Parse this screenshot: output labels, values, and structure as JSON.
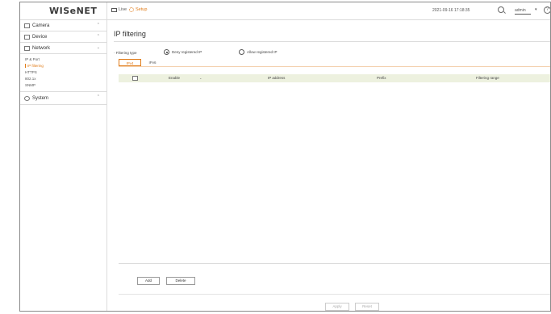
{
  "header": {
    "logo": "WISeNET",
    "tabs": [
      {
        "label": "Live",
        "icon": "monitor-icon"
      },
      {
        "label": "Setup",
        "icon": "gear-icon"
      }
    ],
    "datetime": "2021-09-16 17:18:35",
    "search_icon": "search-icon",
    "user": "admin",
    "help_icon": "help-icon"
  },
  "sidebar": {
    "menus": [
      {
        "label": "Camera",
        "icon": "camera-icon",
        "expanded": false
      },
      {
        "label": "Device",
        "icon": "device-icon",
        "expanded": false
      },
      {
        "label": "Network",
        "icon": "network-icon",
        "expanded": true,
        "items": [
          "IP & Port",
          "IP filtering",
          "HTTPS",
          "802.1x",
          "SNMP"
        ],
        "active_item": "IP filtering"
      },
      {
        "label": "System",
        "icon": "system-gear-icon",
        "expanded": false
      }
    ]
  },
  "main": {
    "title": "IP filtering",
    "filtering_type_label": "Filtering type",
    "radio_deny": "Deny registered IP",
    "radio_allow": "Allow registered IP",
    "selected_radio": "Deny registered IP",
    "tabs": [
      "IPv4",
      "IPv6"
    ],
    "active_tab": "IPv4",
    "table": {
      "columns": [
        "Enable",
        "IP address",
        "Prefix",
        "Filtering range"
      ],
      "rows": []
    },
    "add_button": "Add",
    "delete_button": "Delete",
    "apply_button": "Apply",
    "reset_button": "Reset"
  },
  "colors": {
    "accent": "#e07b18",
    "table_header_bg": "#edf1df",
    "border": "#dcdcdc"
  }
}
